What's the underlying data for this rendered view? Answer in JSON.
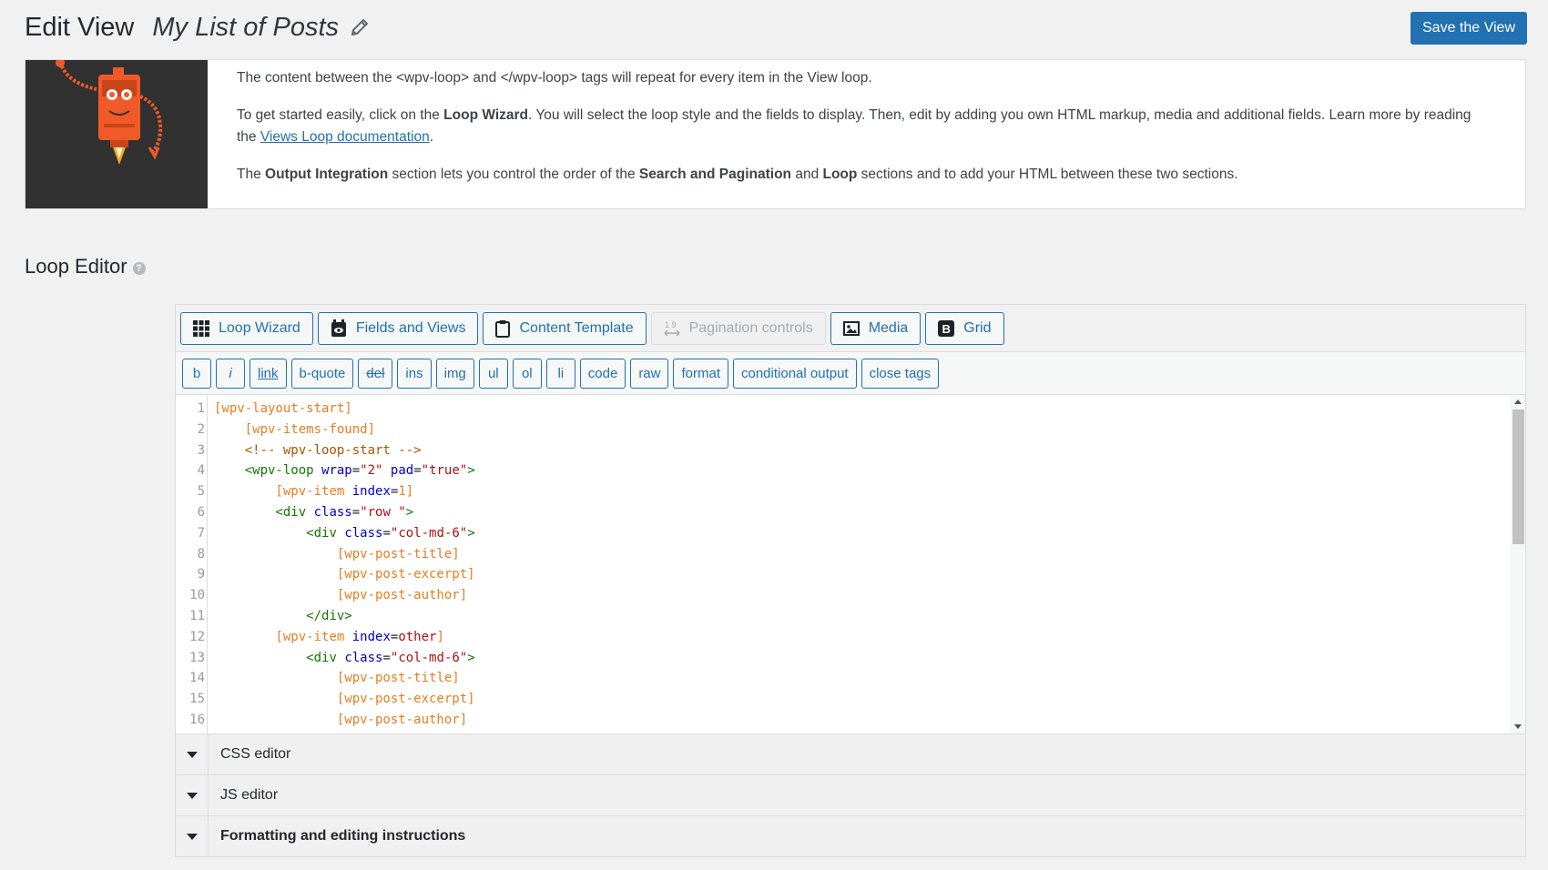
{
  "header": {
    "title": "Edit View",
    "view_name": "My List of Posts",
    "save_label": "Save the View"
  },
  "intro": {
    "p1": {
      "before": "The content between the ",
      "tag_open": "<wpv-loop>",
      "mid": " and ",
      "tag_close": "</wpv-loop>",
      "after": " tags will repeat for every item in the View loop."
    },
    "p2": {
      "before": "To get started easily, click on the ",
      "bold": "Loop Wizard",
      "after": ". You will select the loop style and the fields to display. Then, edit by adding you own HTML markup, media and additional fields. Learn more by reading the ",
      "link": "Views Loop documentation",
      "end": "."
    },
    "p3": {
      "before": "The ",
      "bold1": "Output Integration",
      "mid1": " section lets you control the order of the ",
      "bold2": "Search and Pagination",
      "mid2": " and ",
      "bold3": "Loop",
      "after": " sections and to add your HTML between these two sections."
    }
  },
  "loop_editor": {
    "heading": "Loop Editor",
    "help_icon": "?",
    "toolbar": [
      {
        "label": "Loop Wizard",
        "icon": "grid-icon",
        "disabled": false
      },
      {
        "label": "Fields and Views",
        "icon": "fields-icon",
        "disabled": false
      },
      {
        "label": "Content Template",
        "icon": "clipboard-icon",
        "disabled": false
      },
      {
        "label": "Pagination controls",
        "icon": "pagination-icon",
        "disabled": true
      },
      {
        "label": "Media",
        "icon": "media-icon",
        "disabled": false
      },
      {
        "label": "Grid",
        "icon": "bootstrap-icon",
        "disabled": false
      }
    ],
    "pagination_icon_text": "1 9",
    "bootstrap_icon_text": "B",
    "quicktags": [
      "b",
      "i",
      "link",
      "b-quote",
      "del",
      "ins",
      "img",
      "ul",
      "ol",
      "li",
      "code",
      "raw",
      "format",
      "conditional output",
      "close tags"
    ],
    "code_lines": [
      {
        "n": "1",
        "segments": [
          {
            "t": "[wpv-layout-start]",
            "c": "sc"
          }
        ]
      },
      {
        "n": "2",
        "segments": [
          {
            "t": "    ",
            "c": ""
          },
          {
            "t": "[wpv-items-found]",
            "c": "sc"
          }
        ]
      },
      {
        "n": "3",
        "segments": [
          {
            "t": "    ",
            "c": ""
          },
          {
            "t": "<!-- wpv-loop-start -->",
            "c": "cmt"
          }
        ]
      },
      {
        "n": "4",
        "segments": [
          {
            "t": "    ",
            "c": ""
          },
          {
            "t": "<wpv-loop ",
            "c": "tag"
          },
          {
            "t": "wrap",
            "c": "attr"
          },
          {
            "t": "=",
            "c": ""
          },
          {
            "t": "\"2\"",
            "c": "str"
          },
          {
            "t": " ",
            "c": ""
          },
          {
            "t": "pad",
            "c": "attr"
          },
          {
            "t": "=",
            "c": ""
          },
          {
            "t": "\"true\"",
            "c": "str"
          },
          {
            "t": ">",
            "c": "tag"
          }
        ]
      },
      {
        "n": "5",
        "segments": [
          {
            "t": "        ",
            "c": ""
          },
          {
            "t": "[wpv-item ",
            "c": "sc"
          },
          {
            "t": "index",
            "c": "attr"
          },
          {
            "t": "=",
            "c": ""
          },
          {
            "t": "1",
            "c": "val"
          },
          {
            "t": "]",
            "c": "sc"
          }
        ]
      },
      {
        "n": "6",
        "segments": [
          {
            "t": "        ",
            "c": ""
          },
          {
            "t": "<div ",
            "c": "tag"
          },
          {
            "t": "class",
            "c": "attr"
          },
          {
            "t": "=",
            "c": ""
          },
          {
            "t": "\"row \"",
            "c": "str"
          },
          {
            "t": ">",
            "c": "tag"
          }
        ]
      },
      {
        "n": "7",
        "segments": [
          {
            "t": "            ",
            "c": ""
          },
          {
            "t": "<div ",
            "c": "tag"
          },
          {
            "t": "class",
            "c": "attr"
          },
          {
            "t": "=",
            "c": ""
          },
          {
            "t": "\"col-md-6\"",
            "c": "str"
          },
          {
            "t": ">",
            "c": "tag"
          }
        ]
      },
      {
        "n": "8",
        "segments": [
          {
            "t": "                ",
            "c": ""
          },
          {
            "t": "[wpv-post-title]",
            "c": "sc"
          }
        ]
      },
      {
        "n": "9",
        "segments": [
          {
            "t": "                ",
            "c": ""
          },
          {
            "t": "[wpv-post-excerpt]",
            "c": "sc"
          }
        ]
      },
      {
        "n": "10",
        "segments": [
          {
            "t": "                ",
            "c": ""
          },
          {
            "t": "[wpv-post-author]",
            "c": "sc"
          }
        ]
      },
      {
        "n": "11",
        "segments": [
          {
            "t": "            ",
            "c": ""
          },
          {
            "t": "</div>",
            "c": "tag"
          }
        ]
      },
      {
        "n": "12",
        "segments": [
          {
            "t": "        ",
            "c": ""
          },
          {
            "t": "[wpv-item ",
            "c": "sc"
          },
          {
            "t": "index",
            "c": "attr"
          },
          {
            "t": "=",
            "c": ""
          },
          {
            "t": "other",
            "c": "str"
          },
          {
            "t": "]",
            "c": "sc"
          }
        ]
      },
      {
        "n": "13",
        "segments": [
          {
            "t": "            ",
            "c": ""
          },
          {
            "t": "<div ",
            "c": "tag"
          },
          {
            "t": "class",
            "c": "attr"
          },
          {
            "t": "=",
            "c": ""
          },
          {
            "t": "\"col-md-6\"",
            "c": "str"
          },
          {
            "t": ">",
            "c": "tag"
          }
        ]
      },
      {
        "n": "14",
        "segments": [
          {
            "t": "                ",
            "c": ""
          },
          {
            "t": "[wpv-post-title]",
            "c": "sc"
          }
        ]
      },
      {
        "n": "15",
        "segments": [
          {
            "t": "                ",
            "c": ""
          },
          {
            "t": "[wpv-post-excerpt]",
            "c": "sc"
          }
        ]
      },
      {
        "n": "16",
        "segments": [
          {
            "t": "                ",
            "c": ""
          },
          {
            "t": "[wpv-post-author]",
            "c": "sc"
          }
        ]
      }
    ],
    "panels": [
      {
        "label": "CSS editor",
        "bold": false
      },
      {
        "label": "JS editor",
        "bold": false
      },
      {
        "label": "Formatting and editing instructions",
        "bold": true
      }
    ]
  },
  "colors": {
    "accent": "#2271b1",
    "robot_orange": "#f05a28",
    "robot_bg": "#313131"
  }
}
